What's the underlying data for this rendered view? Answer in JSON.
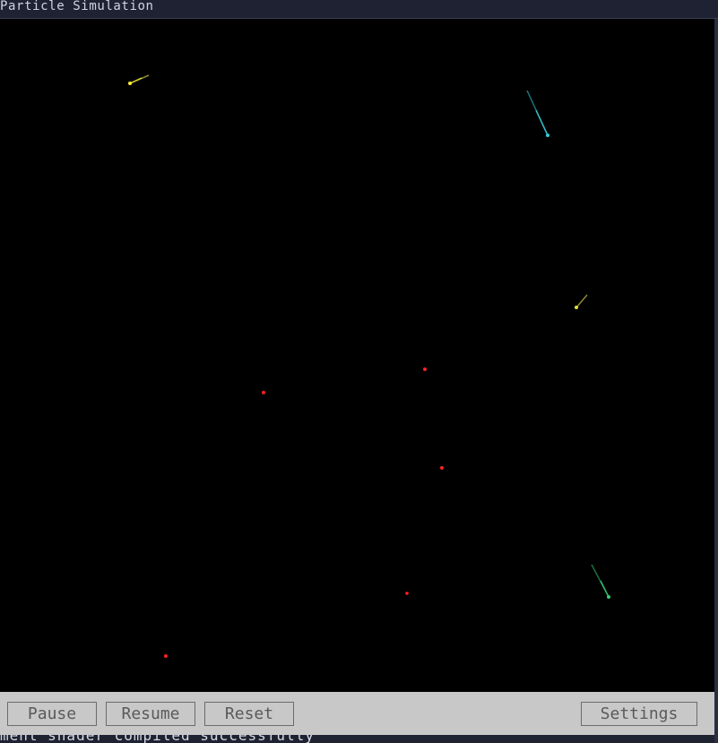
{
  "window": {
    "title": "Particle Simulation"
  },
  "simulation": {
    "particles": [
      {
        "color": "#ffee33",
        "trail": true
      },
      {
        "color": "#33c9d6",
        "trail": true
      },
      {
        "color": "#e6e033",
        "trail": true
      },
      {
        "color": "#ff2222",
        "trail": false
      },
      {
        "color": "#ff2222",
        "trail": false
      },
      {
        "color": "#ff2222",
        "trail": false
      },
      {
        "color": "#ff2222",
        "trail": false
      },
      {
        "color": "#33cc77",
        "trail": true
      },
      {
        "color": "#ff2222",
        "trail": false
      }
    ]
  },
  "toolbar": {
    "pause_label": "Pause",
    "resume_label": "Resume",
    "reset_label": "Reset",
    "settings_label": "Settings"
  },
  "console": {
    "message": "ment shader compiled successfully"
  }
}
